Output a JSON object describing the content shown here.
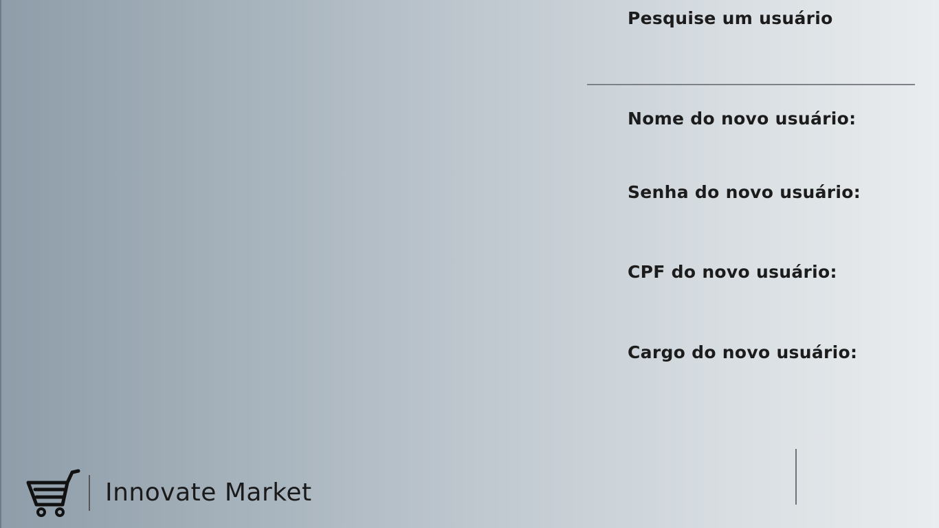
{
  "search": {
    "label": "Pesquise um usuário",
    "value": ""
  },
  "form": {
    "name_label": "Nome do  novo usuário:",
    "password_label": "Senha do novo usuário:",
    "cpf_label": "CPF do novo usuário:",
    "role_label": "Cargo do novo usuário:"
  },
  "brand": {
    "icon": "shopping-cart-icon",
    "name": "Innovate Market"
  },
  "colors": {
    "gradient_start": "#8e9da9",
    "gradient_end": "#eaedef",
    "text": "#1c1c1c",
    "divider": "#7c8287"
  }
}
